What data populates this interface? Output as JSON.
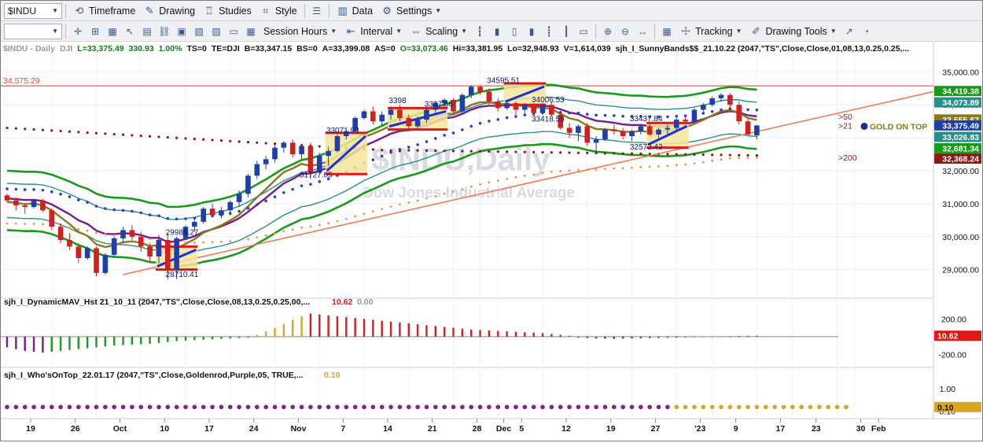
{
  "toolbar1": {
    "symbol": "$INDU",
    "timeframe": "Timeframe",
    "drawing": "Drawing",
    "studies": "Studies",
    "style": "Style",
    "data": "Data",
    "settings": "Settings"
  },
  "toolbar2": {
    "session_hours": "Session Hours",
    "interval": "Interval",
    "scaling": "Scaling",
    "tracking": "Tracking",
    "drawing_tools": "Drawing Tools"
  },
  "info_line": {
    "symbol": "$INDU - Daily",
    "exchange": "DJI",
    "last": "L=33,375.49",
    "change": "330.93",
    "pct": "1.00%",
    "ts": "TS=0",
    "te": "TE=DJI",
    "bid": "B=33,347.15",
    "bs": "BS=0",
    "ask": "A=33,399.08",
    "as": "AS=0",
    "open": "O=33,073.46",
    "high": "Hi=33,381.95",
    "low": "Lo=32,948.93",
    "volume": "V=1,614,039",
    "study": "sjh_I_SunnyBands$$_21.10.22 (2047,\"TS\",Close,Close,01,08,13,0.25,0.25,..."
  },
  "watermark": {
    "title": "$INDU,Daily",
    "subtitle": "Dow Jones Industrial Average"
  },
  "colors": {
    "up": "#1f3ea8",
    "down": "#d21f1f",
    "band_green": "#1a9a1a",
    "band_teal": "#2a8f8a",
    "mav_purple": "#7a1a8f",
    "mav_olive": "#8a7a1a",
    "trend": "#f07a5a",
    "golden": "#daa520",
    "purple_dot": "#8a1a9a"
  },
  "chart_data": [
    {
      "type": "candlestick",
      "title": "",
      "ylim": [
        28300,
        35700
      ],
      "y_ticks": [
        "35,000.00",
        "34,000.00",
        "33,000.00",
        "32,000.00",
        "31,000.00",
        "30,000.00",
        "29,000.00"
      ],
      "y_tick_values": [
        35000,
        34000,
        33000,
        32000,
        31000,
        30000,
        29000
      ],
      "x_tick_labels": [
        "19",
        "26",
        "Oct",
        "10",
        "17",
        "24",
        "Nov",
        "7",
        "14",
        "21",
        "28",
        "Dec",
        "5",
        "12",
        "19",
        "27",
        "'23",
        "9",
        "17",
        "23",
        "30",
        "Feb"
      ],
      "x_tick_bar_index": [
        0,
        5,
        10,
        15,
        20,
        25,
        30,
        35,
        40,
        45,
        50,
        53,
        55,
        60,
        65,
        70,
        75,
        79,
        84,
        88,
        93,
        95
      ],
      "price_labels": [
        {
          "text": "34,419.38",
          "value": 34419.38,
          "color": "#1a9a1a"
        },
        {
          "text": "34,073.89",
          "value": 34073.89,
          "color": "#2a8f8a"
        },
        {
          "text": "33,555.67",
          "value": 33555.67,
          "color": "#8a7a1a"
        },
        {
          "text": "33,375.49",
          "value": 33375.49,
          "color": "#1f3ea8"
        },
        {
          "text": "33,026.83",
          "value": 33026.83,
          "color": "#2a8f8a"
        },
        {
          "text": "32,681.34",
          "value": 32681.34,
          "color": "#1a9a1a"
        },
        {
          "text": "32,368.24",
          "value": 32368.24,
          "color": "#8a1a1a"
        }
      ],
      "horizontal_line": {
        "text": "34,575.29",
        "value": 34575.29
      },
      "annotations": [
        {
          "text": "34595.51",
          "bar": 55,
          "value": 34595.51
        },
        {
          "text": "3398",
          "bar": 44,
          "value": 33980
        },
        {
          "text": "3387.66",
          "bar": 48,
          "value": 33870
        },
        {
          "text": "34006.53",
          "bar": 60,
          "value": 34006.53
        },
        {
          "text": "33071.93",
          "bar": 37,
          "value": 33071.93
        },
        {
          "text": "33418.59",
          "bar": 60,
          "value": 33418.59
        },
        {
          "text": "33437.84",
          "bar": 71,
          "value": 33437.84
        },
        {
          "text": "32573.43",
          "bar": 71,
          "value": 32573.43
        },
        {
          "text": "31727.05",
          "bar": 34,
          "value": 31727.05
        },
        {
          "text": "29985.27",
          "bar": 19,
          "value": 29985.27
        },
        {
          "text": "28710.41",
          "bar": 19,
          "value": 28710.41
        }
      ],
      "side_labels": [
        {
          "text": ">50",
          "value": 33650
        },
        {
          "text": ">21",
          "value": 33375
        },
        {
          "text": ">200",
          "value": 32400
        }
      ],
      "who_on_top": "GOLD ON TOP",
      "candles": [
        [
          31252,
          31300,
          31050,
          31100
        ],
        [
          31100,
          31200,
          30800,
          30950
        ],
        [
          30950,
          31000,
          30700,
          30900
        ],
        [
          30900,
          31150,
          30850,
          31100
        ],
        [
          31100,
          31150,
          30750,
          30800
        ],
        [
          30800,
          30850,
          30200,
          30300
        ],
        [
          30300,
          30400,
          29800,
          29900
        ],
        [
          29900,
          30100,
          29600,
          29700
        ],
        [
          29700,
          29800,
          29200,
          29350
        ],
        [
          29350,
          29700,
          29300,
          29650
        ],
        [
          29650,
          29700,
          28800,
          28900
        ],
        [
          28900,
          29500,
          28850,
          29450
        ],
        [
          29450,
          30000,
          29400,
          29950
        ],
        [
          29950,
          30300,
          29800,
          30200
        ],
        [
          30200,
          30350,
          29900,
          30000
        ],
        [
          30000,
          30150,
          29550,
          29700
        ],
        [
          29700,
          29800,
          29250,
          29400
        ],
        [
          29400,
          30050,
          29200,
          29900
        ],
        [
          29900,
          30100,
          28700,
          29000
        ],
        [
          29000,
          30000,
          28710,
          29950
        ],
        [
          29950,
          30350,
          29900,
          30300
        ],
        [
          30300,
          30500,
          30150,
          30450
        ],
        [
          30450,
          30900,
          30400,
          30850
        ],
        [
          30850,
          31000,
          30600,
          30650
        ],
        [
          30650,
          30900,
          30550,
          30800
        ],
        [
          30800,
          31100,
          30650,
          31050
        ],
        [
          31050,
          31400,
          30900,
          31300
        ],
        [
          31300,
          31900,
          31200,
          31850
        ],
        [
          31850,
          32300,
          31750,
          32200
        ],
        [
          32200,
          32450,
          32050,
          32350
        ],
        [
          32350,
          32800,
          32250,
          32700
        ],
        [
          32700,
          32900,
          32550,
          32850
        ],
        [
          32850,
          32950,
          32400,
          32500
        ],
        [
          32500,
          32800,
          32350,
          32750
        ],
        [
          32750,
          32850,
          31750,
          31950
        ],
        [
          31950,
          32550,
          31900,
          32450
        ],
        [
          32450,
          32700,
          32150,
          32600
        ],
        [
          32600,
          33100,
          32550,
          33050
        ],
        [
          33050,
          33250,
          32950,
          33200
        ],
        [
          33200,
          33650,
          33150,
          33600
        ],
        [
          33600,
          33850,
          33550,
          33800
        ],
        [
          33800,
          33950,
          33400,
          33500
        ],
        [
          33500,
          33800,
          33350,
          33700
        ],
        [
          33700,
          33950,
          33550,
          33850
        ],
        [
          33850,
          34000,
          33500,
          33600
        ],
        [
          33600,
          33700,
          33200,
          33350
        ],
        [
          33350,
          33650,
          33300,
          33550
        ],
        [
          33550,
          33900,
          33450,
          33850
        ],
        [
          33850,
          34100,
          33750,
          34050
        ],
        [
          34050,
          34200,
          33900,
          34150
        ],
        [
          34150,
          34200,
          33700,
          33800
        ],
        [
          33800,
          34350,
          33750,
          34300
        ],
        [
          34300,
          34600,
          34200,
          34550
        ],
        [
          34550,
          34600,
          34300,
          34400
        ],
        [
          34400,
          34500,
          33950,
          34100
        ],
        [
          34100,
          34200,
          33800,
          33900
        ],
        [
          33900,
          34150,
          33850,
          34050
        ],
        [
          34050,
          34100,
          33700,
          33850
        ],
        [
          33850,
          34050,
          33750,
          34000
        ],
        [
          34000,
          34050,
          33700,
          33750
        ],
        [
          33750,
          34050,
          33700,
          34000
        ],
        [
          34000,
          34100,
          33650,
          33700
        ],
        [
          33700,
          33750,
          33250,
          33300
        ],
        [
          33300,
          33450,
          33000,
          33150
        ],
        [
          33150,
          33400,
          32900,
          33350
        ],
        [
          33350,
          33450,
          32750,
          32850
        ],
        [
          32850,
          33050,
          32573,
          32950
        ],
        [
          32950,
          33300,
          32900,
          33250
        ],
        [
          33250,
          33400,
          33100,
          33200
        ],
        [
          33200,
          33300,
          32950,
          33050
        ],
        [
          33050,
          33250,
          32900,
          33200
        ],
        [
          33200,
          33400,
          33100,
          33350
        ],
        [
          33350,
          33450,
          33050,
          33100
        ],
        [
          33100,
          33300,
          33000,
          33250
        ],
        [
          33250,
          33400,
          33100,
          33300
        ],
        [
          33300,
          33600,
          33200,
          33550
        ],
        [
          33550,
          33700,
          33400,
          33500
        ],
        [
          33500,
          33900,
          33450,
          33850
        ],
        [
          33850,
          34050,
          33800,
          34000
        ],
        [
          34000,
          34250,
          33950,
          34200
        ],
        [
          34200,
          34350,
          34100,
          34300
        ],
        [
          34300,
          34350,
          33900,
          34000
        ],
        [
          34000,
          34100,
          33400,
          33500
        ],
        [
          33500,
          33600,
          33050,
          33100
        ],
        [
          33073,
          33382,
          32949,
          33375
        ]
      ]
    },
    {
      "type": "bar",
      "title": "sjh_I_DynamicMAV_Hst 21_10_11 (2047,\"TS\",Close,Close,08,13,0.25,0.25,00,...",
      "value1": "10.62",
      "value2": "0.00",
      "ylim": [
        -320,
        300
      ],
      "y_ticks": [
        "200.00",
        "-200.00"
      ],
      "y_tick_values": [
        200,
        -200
      ],
      "last_label": "10.62",
      "values": [
        -120,
        -140,
        -160,
        -170,
        -180,
        -170,
        -160,
        -150,
        -140,
        -130,
        -120,
        -110,
        -100,
        -95,
        -90,
        -85,
        -80,
        -70,
        -60,
        -50,
        -45,
        -40,
        -35,
        -30,
        -25,
        -20,
        -15,
        -10,
        20,
        60,
        100,
        140,
        190,
        230,
        260,
        250,
        240,
        230,
        220,
        210,
        200,
        190,
        180,
        170,
        160,
        150,
        140,
        130,
        120,
        110,
        100,
        90,
        80,
        75,
        70,
        65,
        60,
        55,
        50,
        45,
        40,
        30,
        20,
        10,
        -10,
        -15,
        -20,
        -22,
        -24,
        -22,
        -20,
        -18,
        -16,
        -14,
        -12,
        -10,
        -8,
        -6,
        -5,
        -4,
        -3,
        5,
        8,
        10,
        10.62
      ],
      "colors_by_sign": {
        "neg_early": "#7a1a8f",
        "neg_mid": "#1a9a1a",
        "pos_rise": "#daa520",
        "pos_fall": "#d21f1f"
      }
    },
    {
      "type": "scatter",
      "title": "sjh_I_Who'sOnTop_22.01.17 (2047,\"TS\",Close,Goldenrod,Purple,05, TRUE,...",
      "value": "0.10",
      "ylim": [
        -0.35,
        1.3
      ],
      "y_ticks": [
        "1.00",
        "-0.10"
      ],
      "y_tick_values": [
        1.0,
        -0.1
      ],
      "last_label": "0.10",
      "switch_bar": 75
    }
  ]
}
